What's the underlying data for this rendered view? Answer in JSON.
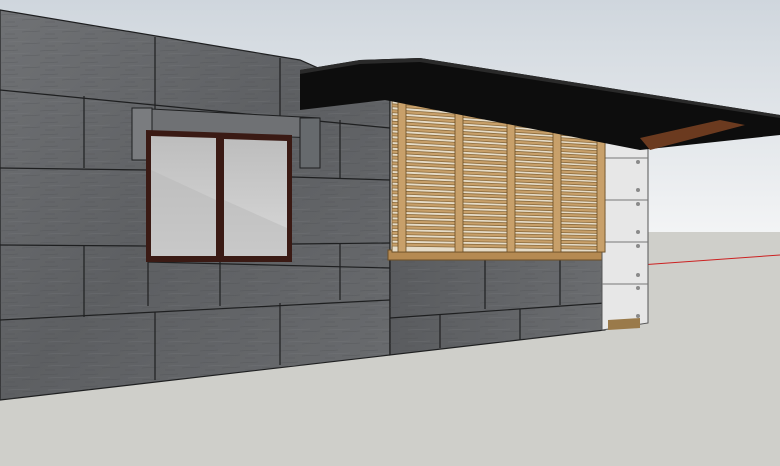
{
  "viewport": {
    "description_visible_text": "",
    "axis_color": "#cc2222"
  },
  "colors": {
    "sky_top": "#cfd6dd",
    "sky_bottom": "#f2f4f6",
    "ground": "#cfcfca",
    "stone_light": "#6e7073",
    "stone_dark": "#4f5154",
    "mortar": "#1e1f20",
    "window_frame": "#3a1a14",
    "glass": "#c9c9c9",
    "wood": "#c8a06a",
    "wood_dark": "#8a6a3c",
    "awning": "#0d0d0d",
    "awning_under": "#6b3a1f",
    "concrete_panel": "#e7e7e7"
  },
  "model": {
    "wall_name": "stone-wall",
    "window_name": "window",
    "screen_name": "wood-slat-screen",
    "awning_name": "awning",
    "panel_name": "concrete-panels"
  }
}
